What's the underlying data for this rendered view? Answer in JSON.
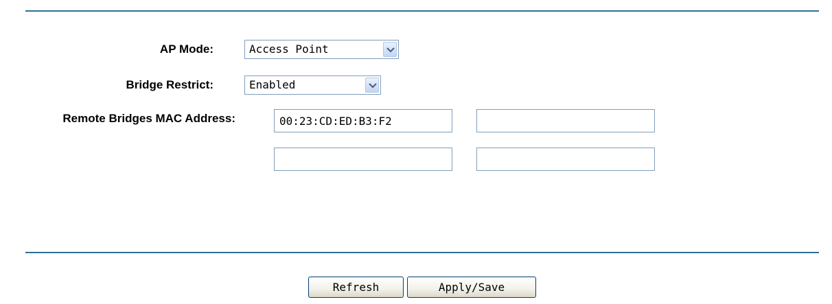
{
  "form": {
    "ap_mode": {
      "label": "AP Mode:",
      "value": "Access Point"
    },
    "bridge_restrict": {
      "label": "Bridge Restrict:",
      "value": "Enabled"
    },
    "remote_bridges": {
      "label": "Remote Bridges MAC Address:",
      "mac1": "00:23:CD:ED:B3:F2",
      "mac2": "",
      "mac3": "",
      "mac4": ""
    }
  },
  "buttons": {
    "refresh": "Refresh",
    "apply_save": "Apply/Save"
  },
  "colors": {
    "divider": "#2e6f93",
    "field_border": "#7f9db9",
    "button_border": "#003c74"
  },
  "icons": {
    "dropdown": "chevron-down-icon"
  }
}
